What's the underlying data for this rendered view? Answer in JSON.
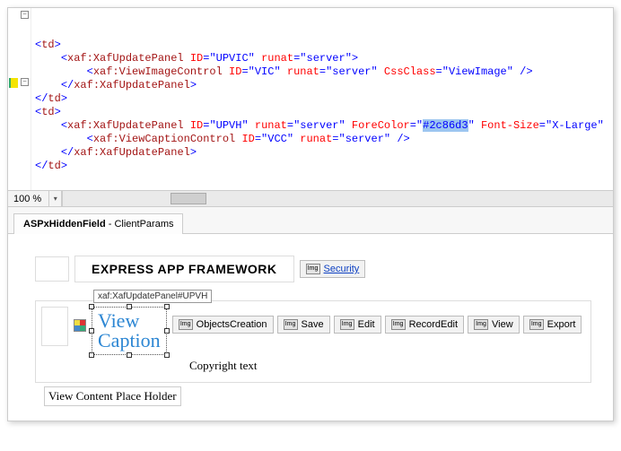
{
  "code": {
    "line1_a": "<",
    "line1_tag": "td",
    "line1_b": ">",
    "line2_a": "<",
    "line2_tag": "xaf:XafUpdatePanel",
    "line2_attr1": " ID",
    "line2_eq": "=\"",
    "line2_val1": "UPVIC",
    "line2_q": "\"",
    "line2_attr2": " runat",
    "line2_val2": "server",
    "line2_end": ">",
    "line3_a": "<",
    "line3_tag": "xaf:ViewImageControl",
    "line3_attr1": " ID",
    "line3_val1": "VIC",
    "line3_attr2": " runat",
    "line3_val2": "server",
    "line3_attr3": " CssClass",
    "line3_val3": "ViewImage",
    "line3_end": " />",
    "line4_a": "</",
    "line4_tag": "xaf:XafUpdatePanel",
    "line4_b": ">",
    "line5_a": "</",
    "line5_tag": "td",
    "line5_b": ">",
    "line6_a": "<",
    "line6_tag": "td",
    "line6_b": ">",
    "line7_a": "<",
    "line7_tag": "xaf:XafUpdatePanel",
    "line7_attr1": " ID",
    "line7_val1": "UPVH",
    "line7_attr2": " runat",
    "line7_val2": "server",
    "line7_attr3": " ForeColor",
    "line7_val3": "#2c86d3",
    "line7_attr4": " Font-Size",
    "line7_val4": "X-Large",
    "line7_end": "\"",
    "line8_a": "<",
    "line8_tag": "xaf:ViewCaptionControl",
    "line8_attr1": " ID",
    "line8_val1": "VCC",
    "line8_attr2": " runat",
    "line8_val2": "server",
    "line8_end": " />",
    "line9_a": "</",
    "line9_tag": "xaf:XafUpdatePanel",
    "line9_b": ">",
    "line10_a": "</",
    "line10_tag": "td",
    "line10_b": ">"
  },
  "zoom": "100 %",
  "tab": {
    "bold": "ASPxHiddenField",
    "rest": " - ClientParams"
  },
  "header": {
    "title": "EXPRESS APP FRAMEWORK",
    "img_chip": "Img",
    "security": "Security"
  },
  "designer": {
    "tag_chip": "xaf:XafUpdatePanel#UPVH",
    "caption_l1": "View",
    "caption_l2": "Caption",
    "buttons": [
      "ObjectsCreation",
      "Save",
      "Edit",
      "RecordEdit",
      "View",
      "Export"
    ],
    "img_chip": "Img",
    "copyright": "Copyright text",
    "view_content": "View Content Place Holder"
  }
}
